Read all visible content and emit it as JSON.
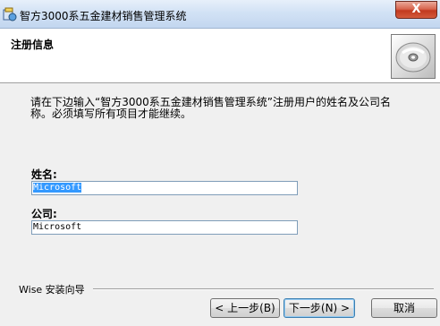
{
  "window": {
    "title": "智方3000系五金建材销售管理系统",
    "close_label": "X"
  },
  "icons": {
    "app": "installer-app-icon",
    "header": "cd-disc-icon"
  },
  "header": {
    "title": "注册信息"
  },
  "body": {
    "instruction_line1": "请在下边输入“智方3000系五金建材销售管理系统”注册用户的姓名及公司名",
    "instruction_line2": "称。必须填写所有项目才能继续。"
  },
  "form": {
    "name_label": "姓名:",
    "name_value": "Microsoft",
    "company_label": "公司:",
    "company_value": "Microsoft"
  },
  "footer": {
    "brand_label": "Wise 安装向导",
    "back_label": "< 上一步(B)",
    "next_label": "下一步(N) >",
    "cancel_label": "取消"
  }
}
